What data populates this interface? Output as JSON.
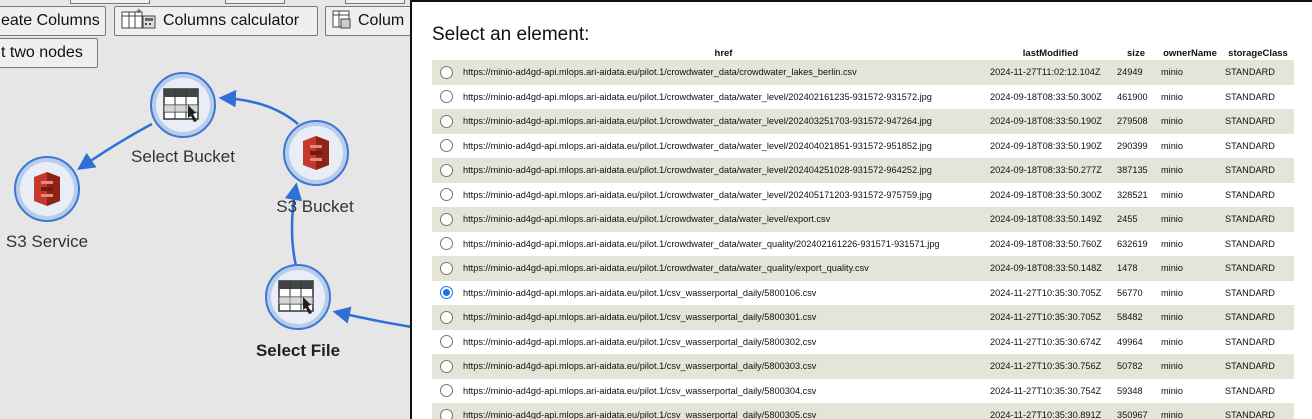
{
  "toolbar": {
    "create_columns_label": "eate Columns",
    "columns_calculator_label": "Columns calculator",
    "third_button_label": "Colum",
    "select_two_nodes_label": "t two nodes"
  },
  "workflow": {
    "nodes": {
      "select_bucket": "Select Bucket",
      "s3_service": "S3 Service",
      "s3_bucket": "S3 Bucket",
      "select_file": "Select File"
    }
  },
  "colors": {
    "edge": "#2f6fd6",
    "node_ring": "#3f78d4",
    "row_alt": "#e4e4d8",
    "radio_checked": "#1a73e8"
  },
  "dialog": {
    "title": "Select an element:",
    "columns": [
      "href",
      "lastModified",
      "size",
      "ownerName",
      "storageClass"
    ],
    "rows": [
      {
        "selected": false,
        "href": "https://minio-ad4gd-api.mlops.ari-aidata.eu/pilot.1/crowdwater_data/crowdwater_lakes_berlin.csv",
        "lastModified": "2024-11-27T11:02:12.104Z",
        "size": "24949",
        "ownerName": "minio",
        "storageClass": "STANDARD"
      },
      {
        "selected": false,
        "href": "https://minio-ad4gd-api.mlops.ari-aidata.eu/pilot.1/crowdwater_data/water_level/202402161235-931572-931572.jpg",
        "lastModified": "2024-09-18T08:33:50.300Z",
        "size": "461900",
        "ownerName": "minio",
        "storageClass": "STANDARD"
      },
      {
        "selected": false,
        "href": "https://minio-ad4gd-api.mlops.ari-aidata.eu/pilot.1/crowdwater_data/water_level/202403251703-931572-947264.jpg",
        "lastModified": "2024-09-18T08:33:50.190Z",
        "size": "279508",
        "ownerName": "minio",
        "storageClass": "STANDARD"
      },
      {
        "selected": false,
        "href": "https://minio-ad4gd-api.mlops.ari-aidata.eu/pilot.1/crowdwater_data/water_level/202404021851-931572-951852.jpg",
        "lastModified": "2024-09-18T08:33:50.190Z",
        "size": "290399",
        "ownerName": "minio",
        "storageClass": "STANDARD"
      },
      {
        "selected": false,
        "href": "https://minio-ad4gd-api.mlops.ari-aidata.eu/pilot.1/crowdwater_data/water_level/202404251028-931572-964252.jpg",
        "lastModified": "2024-09-18T08:33:50.277Z",
        "size": "387135",
        "ownerName": "minio",
        "storageClass": "STANDARD"
      },
      {
        "selected": false,
        "href": "https://minio-ad4gd-api.mlops.ari-aidata.eu/pilot.1/crowdwater_data/water_level/202405171203-931572-975759.jpg",
        "lastModified": "2024-09-18T08:33:50.300Z",
        "size": "328521",
        "ownerName": "minio",
        "storageClass": "STANDARD"
      },
      {
        "selected": false,
        "href": "https://minio-ad4gd-api.mlops.ari-aidata.eu/pilot.1/crowdwater_data/water_level/export.csv",
        "lastModified": "2024-09-18T08:33:50.149Z",
        "size": "2455",
        "ownerName": "minio",
        "storageClass": "STANDARD"
      },
      {
        "selected": false,
        "href": "https://minio-ad4gd-api.mlops.ari-aidata.eu/pilot.1/crowdwater_data/water_quality/202402161226-931571-931571.jpg",
        "lastModified": "2024-09-18T08:33:50.760Z",
        "size": "632619",
        "ownerName": "minio",
        "storageClass": "STANDARD"
      },
      {
        "selected": false,
        "href": "https://minio-ad4gd-api.mlops.ari-aidata.eu/pilot.1/crowdwater_data/water_quality/export_quality.csv",
        "lastModified": "2024-09-18T08:33:50.148Z",
        "size": "1478",
        "ownerName": "minio",
        "storageClass": "STANDARD"
      },
      {
        "selected": true,
        "href": "https://minio-ad4gd-api.mlops.ari-aidata.eu/pilot.1/csv_wasserportal_daily/5800106.csv",
        "lastModified": "2024-11-27T10:35:30.705Z",
        "size": "56770",
        "ownerName": "minio",
        "storageClass": "STANDARD"
      },
      {
        "selected": false,
        "href": "https://minio-ad4gd-api.mlops.ari-aidata.eu/pilot.1/csv_wasserportal_daily/5800301.csv",
        "lastModified": "2024-11-27T10:35:30.705Z",
        "size": "58482",
        "ownerName": "minio",
        "storageClass": "STANDARD"
      },
      {
        "selected": false,
        "href": "https://minio-ad4gd-api.mlops.ari-aidata.eu/pilot.1/csv_wasserportal_daily/5800302.csv",
        "lastModified": "2024-11-27T10:35:30.674Z",
        "size": "49964",
        "ownerName": "minio",
        "storageClass": "STANDARD"
      },
      {
        "selected": false,
        "href": "https://minio-ad4gd-api.mlops.ari-aidata.eu/pilot.1/csv_wasserportal_daily/5800303.csv",
        "lastModified": "2024-11-27T10:35:30.756Z",
        "size": "50782",
        "ownerName": "minio",
        "storageClass": "STANDARD"
      },
      {
        "selected": false,
        "href": "https://minio-ad4gd-api.mlops.ari-aidata.eu/pilot.1/csv_wasserportal_daily/5800304.csv",
        "lastModified": "2024-11-27T10:35:30.754Z",
        "size": "59348",
        "ownerName": "minio",
        "storageClass": "STANDARD"
      },
      {
        "selected": false,
        "href": "https://minio-ad4gd-api.mlops.ari-aidata.eu/pilot.1/csv_wasserportal_daily/5800305.csv",
        "lastModified": "2024-11-27T10:35:30.891Z",
        "size": "350967",
        "ownerName": "minio",
        "storageClass": "STANDARD"
      }
    ]
  }
}
